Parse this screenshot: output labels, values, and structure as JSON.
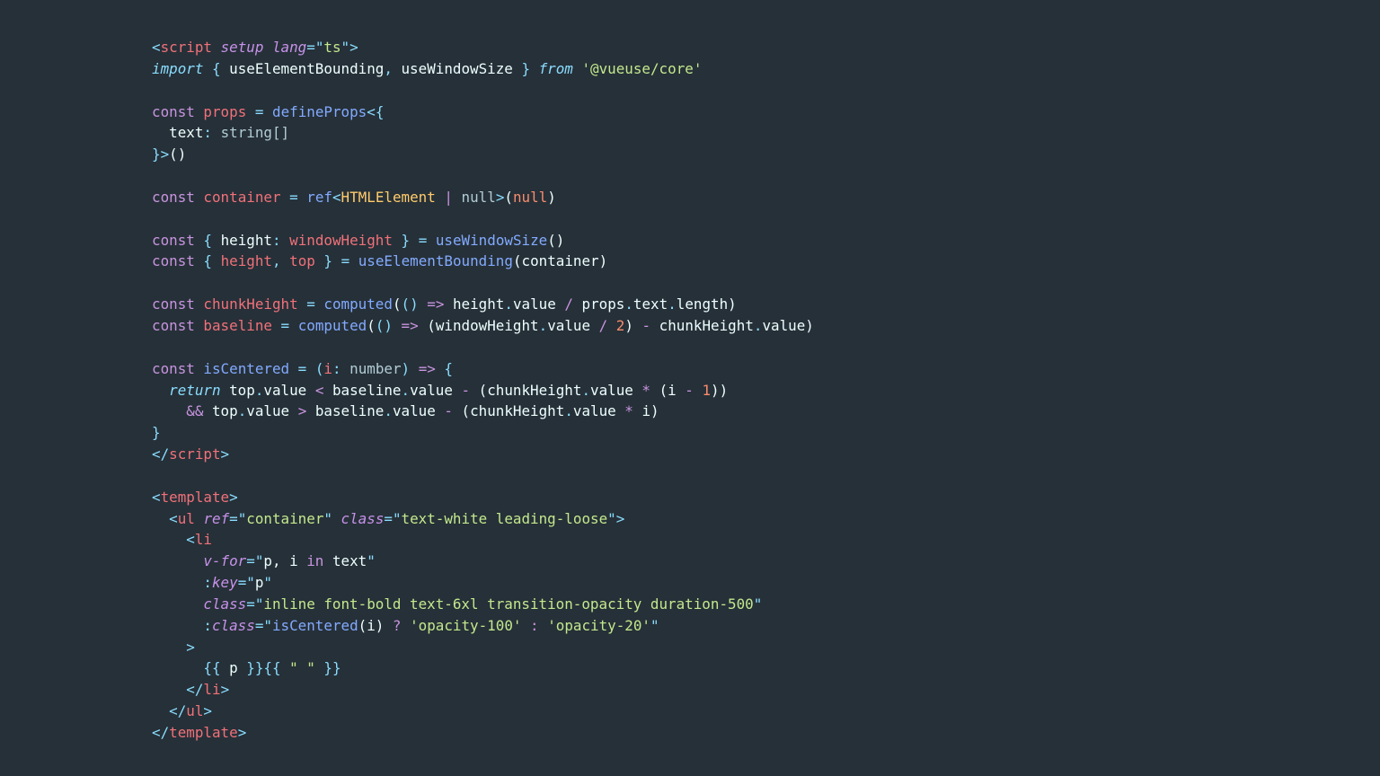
{
  "editor": {
    "language": "vue",
    "lines": [
      [
        [
          "pun",
          "<"
        ],
        [
          "tag",
          "script"
        ],
        [
          "txt",
          " "
        ],
        [
          "attr",
          "setup"
        ],
        [
          "txt",
          " "
        ],
        [
          "attr",
          "lang"
        ],
        [
          "pun",
          "=\""
        ],
        [
          "str",
          "ts"
        ],
        [
          "pun",
          "\">"
        ]
      ],
      [
        [
          "kwi",
          "import"
        ],
        [
          "txt",
          " "
        ],
        [
          "pun",
          "{"
        ],
        [
          "txt",
          " useElementBounding"
        ],
        [
          "pun",
          ","
        ],
        [
          "txt",
          " useWindowSize "
        ],
        [
          "pun",
          "}"
        ],
        [
          "txt",
          " "
        ],
        [
          "kwi",
          "from"
        ],
        [
          "txt",
          " "
        ],
        [
          "str",
          "'@vueuse/core'"
        ]
      ],
      [],
      [
        [
          "kw",
          "const"
        ],
        [
          "txt",
          " "
        ],
        [
          "var",
          "props"
        ],
        [
          "txt",
          " "
        ],
        [
          "op",
          "="
        ],
        [
          "txt",
          " "
        ],
        [
          "fn",
          "defineProps"
        ],
        [
          "pun",
          "<{"
        ]
      ],
      [
        [
          "txt",
          "  text"
        ],
        [
          "pun",
          ":"
        ],
        [
          "txt",
          " "
        ],
        [
          "dim",
          "string[]"
        ]
      ],
      [
        [
          "pun",
          "}>"
        ],
        [
          "txt",
          "()"
        ]
      ],
      [],
      [
        [
          "kw",
          "const"
        ],
        [
          "txt",
          " "
        ],
        [
          "var",
          "container"
        ],
        [
          "txt",
          " "
        ],
        [
          "op",
          "="
        ],
        [
          "txt",
          " "
        ],
        [
          "fn",
          "ref"
        ],
        [
          "pun",
          "<"
        ],
        [
          "type",
          "HTMLElement"
        ],
        [
          "txt",
          " "
        ],
        [
          "kw",
          "|"
        ],
        [
          "txt",
          " "
        ],
        [
          "dim",
          "null"
        ],
        [
          "pun",
          ">"
        ],
        [
          "txt",
          "("
        ],
        [
          "num",
          "null"
        ],
        [
          "txt",
          ")"
        ]
      ],
      [],
      [
        [
          "kw",
          "const"
        ],
        [
          "txt",
          " "
        ],
        [
          "pun",
          "{"
        ],
        [
          "txt",
          " height"
        ],
        [
          "pun",
          ":"
        ],
        [
          "txt",
          " "
        ],
        [
          "var",
          "windowHeight"
        ],
        [
          "txt",
          " "
        ],
        [
          "pun",
          "}"
        ],
        [
          "txt",
          " "
        ],
        [
          "op",
          "="
        ],
        [
          "txt",
          " "
        ],
        [
          "fn",
          "useWindowSize"
        ],
        [
          "txt",
          "()"
        ]
      ],
      [
        [
          "kw",
          "const"
        ],
        [
          "txt",
          " "
        ],
        [
          "pun",
          "{"
        ],
        [
          "txt",
          " "
        ],
        [
          "var",
          "height"
        ],
        [
          "pun",
          ","
        ],
        [
          "txt",
          " "
        ],
        [
          "var",
          "top"
        ],
        [
          "txt",
          " "
        ],
        [
          "pun",
          "}"
        ],
        [
          "txt",
          " "
        ],
        [
          "op",
          "="
        ],
        [
          "txt",
          " "
        ],
        [
          "fn",
          "useElementBounding"
        ],
        [
          "txt",
          "(container)"
        ]
      ],
      [],
      [
        [
          "kw",
          "const"
        ],
        [
          "txt",
          " "
        ],
        [
          "var",
          "chunkHeight"
        ],
        [
          "txt",
          " "
        ],
        [
          "op",
          "="
        ],
        [
          "txt",
          " "
        ],
        [
          "fn",
          "computed"
        ],
        [
          "txt",
          "("
        ],
        [
          "pun",
          "()"
        ],
        [
          "txt",
          " "
        ],
        [
          "kw",
          "=>"
        ],
        [
          "txt",
          " height"
        ],
        [
          "pun",
          "."
        ],
        [
          "txt",
          "value "
        ],
        [
          "kw",
          "/"
        ],
        [
          "txt",
          " props"
        ],
        [
          "pun",
          "."
        ],
        [
          "txt",
          "text"
        ],
        [
          "pun",
          "."
        ],
        [
          "txt",
          "length)"
        ]
      ],
      [
        [
          "kw",
          "const"
        ],
        [
          "txt",
          " "
        ],
        [
          "var",
          "baseline"
        ],
        [
          "txt",
          " "
        ],
        [
          "op",
          "="
        ],
        [
          "txt",
          " "
        ],
        [
          "fn",
          "computed"
        ],
        [
          "txt",
          "("
        ],
        [
          "pun",
          "()"
        ],
        [
          "txt",
          " "
        ],
        [
          "kw",
          "=>"
        ],
        [
          "txt",
          " (windowHeight"
        ],
        [
          "pun",
          "."
        ],
        [
          "txt",
          "value "
        ],
        [
          "kw",
          "/"
        ],
        [
          "txt",
          " "
        ],
        [
          "num",
          "2"
        ],
        [
          "txt",
          ") "
        ],
        [
          "kw",
          "-"
        ],
        [
          "txt",
          " chunkHeight"
        ],
        [
          "pun",
          "."
        ],
        [
          "txt",
          "value)"
        ]
      ],
      [],
      [
        [
          "kw",
          "const"
        ],
        [
          "txt",
          " "
        ],
        [
          "fn",
          "isCentered"
        ],
        [
          "txt",
          " "
        ],
        [
          "op",
          "="
        ],
        [
          "txt",
          " "
        ],
        [
          "pun",
          "("
        ],
        [
          "var",
          "i"
        ],
        [
          "pun",
          ":"
        ],
        [
          "txt",
          " "
        ],
        [
          "dim",
          "number"
        ],
        [
          "pun",
          ")"
        ],
        [
          "txt",
          " "
        ],
        [
          "kw",
          "=>"
        ],
        [
          "txt",
          " "
        ],
        [
          "pun",
          "{"
        ]
      ],
      [
        [
          "txt",
          "  "
        ],
        [
          "kwi",
          "return"
        ],
        [
          "txt",
          " top"
        ],
        [
          "pun",
          "."
        ],
        [
          "txt",
          "value "
        ],
        [
          "kw",
          "<"
        ],
        [
          "txt",
          " baseline"
        ],
        [
          "pun",
          "."
        ],
        [
          "txt",
          "value "
        ],
        [
          "kw",
          "-"
        ],
        [
          "txt",
          " (chunkHeight"
        ],
        [
          "pun",
          "."
        ],
        [
          "txt",
          "value "
        ],
        [
          "kw",
          "*"
        ],
        [
          "txt",
          " (i "
        ],
        [
          "kw",
          "-"
        ],
        [
          "txt",
          " "
        ],
        [
          "num",
          "1"
        ],
        [
          "txt",
          "))"
        ]
      ],
      [
        [
          "txt",
          "    "
        ],
        [
          "kw",
          "&&"
        ],
        [
          "txt",
          " top"
        ],
        [
          "pun",
          "."
        ],
        [
          "txt",
          "value "
        ],
        [
          "kw",
          ">"
        ],
        [
          "txt",
          " baseline"
        ],
        [
          "pun",
          "."
        ],
        [
          "txt",
          "value "
        ],
        [
          "kw",
          "-"
        ],
        [
          "txt",
          " (chunkHeight"
        ],
        [
          "pun",
          "."
        ],
        [
          "txt",
          "value "
        ],
        [
          "kw",
          "*"
        ],
        [
          "txt",
          " i)"
        ]
      ],
      [
        [
          "pun",
          "}"
        ]
      ],
      [
        [
          "pun",
          "</"
        ],
        [
          "tag",
          "script"
        ],
        [
          "pun",
          ">"
        ]
      ],
      [],
      [
        [
          "pun",
          "<"
        ],
        [
          "tag",
          "template"
        ],
        [
          "pun",
          ">"
        ]
      ],
      [
        [
          "txt",
          "  "
        ],
        [
          "pun",
          "<"
        ],
        [
          "tag",
          "ul"
        ],
        [
          "txt",
          " "
        ],
        [
          "attr",
          "ref"
        ],
        [
          "pun",
          "=\""
        ],
        [
          "str",
          "container"
        ],
        [
          "pun",
          "\""
        ],
        [
          "txt",
          " "
        ],
        [
          "attr",
          "class"
        ],
        [
          "pun",
          "=\""
        ],
        [
          "str",
          "text-white leading-loose"
        ],
        [
          "pun",
          "\">"
        ]
      ],
      [
        [
          "txt",
          "    "
        ],
        [
          "pun",
          "<"
        ],
        [
          "tag",
          "li"
        ]
      ],
      [
        [
          "txt",
          "      "
        ],
        [
          "attr",
          "v-for"
        ],
        [
          "pun",
          "=\""
        ],
        [
          "txt",
          "p, i "
        ],
        [
          "kw",
          "in"
        ],
        [
          "txt",
          " text"
        ],
        [
          "pun",
          "\""
        ]
      ],
      [
        [
          "txt",
          "      "
        ],
        [
          "pun",
          ":"
        ],
        [
          "attr",
          "key"
        ],
        [
          "pun",
          "=\""
        ],
        [
          "txt",
          "p"
        ],
        [
          "pun",
          "\""
        ]
      ],
      [
        [
          "txt",
          "      "
        ],
        [
          "attr",
          "class"
        ],
        [
          "pun",
          "=\""
        ],
        [
          "str",
          "inline font-bold text-6xl transition-opacity duration-500"
        ],
        [
          "pun",
          "\""
        ]
      ],
      [
        [
          "txt",
          "      "
        ],
        [
          "pun",
          ":"
        ],
        [
          "attr",
          "class"
        ],
        [
          "pun",
          "=\""
        ],
        [
          "fn",
          "isCentered"
        ],
        [
          "txt",
          "(i) "
        ],
        [
          "kw",
          "?"
        ],
        [
          "txt",
          " "
        ],
        [
          "str",
          "'opacity-100'"
        ],
        [
          "txt",
          " "
        ],
        [
          "kw",
          ":"
        ],
        [
          "txt",
          " "
        ],
        [
          "str",
          "'opacity-20'"
        ],
        [
          "pun",
          "\""
        ]
      ],
      [
        [
          "txt",
          "    "
        ],
        [
          "pun",
          ">"
        ]
      ],
      [
        [
          "txt",
          "      "
        ],
        [
          "pun",
          "{{"
        ],
        [
          "txt",
          " p "
        ],
        [
          "pun",
          "}}{{"
        ],
        [
          "txt",
          " "
        ],
        [
          "str",
          "\" \""
        ],
        [
          "txt",
          " "
        ],
        [
          "pun",
          "}}"
        ]
      ],
      [
        [
          "txt",
          "    "
        ],
        [
          "pun",
          "</"
        ],
        [
          "tag",
          "li"
        ],
        [
          "pun",
          ">"
        ]
      ],
      [
        [
          "txt",
          "  "
        ],
        [
          "pun",
          "</"
        ],
        [
          "tag",
          "ul"
        ],
        [
          "pun",
          ">"
        ]
      ],
      [
        [
          "pun",
          "</"
        ],
        [
          "tag",
          "template"
        ],
        [
          "pun",
          ">"
        ]
      ]
    ]
  }
}
